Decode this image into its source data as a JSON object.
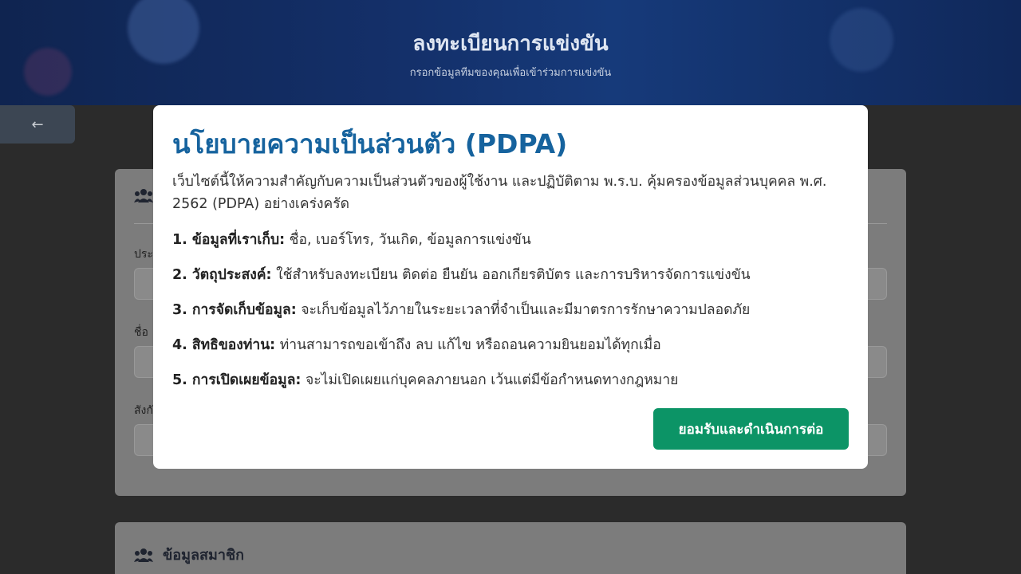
{
  "header": {
    "title": "ลงทะเบียนการแข่งขัน",
    "subtitle": "กรอกข้อมูลทีมของคุณเพื่อเข้าร่วมการแข่งขัน"
  },
  "back_button": {
    "icon": "arrow-left-icon",
    "glyph": "←"
  },
  "form": {
    "card1": {
      "fields": [
        {
          "label": "ประ"
        },
        {
          "label": "ชื่อ"
        },
        {
          "label": "สังกั"
        }
      ]
    },
    "card2": {
      "title": "ข้อมูลสมาชิก"
    }
  },
  "modal": {
    "title": "นโยบายความเป็นส่วนตัว (PDPA)",
    "intro": "เว็บไซต์นี้ให้ความสำคัญกับความเป็นส่วนตัวของผู้ใช้งาน และปฏิบัติตาม พ.ร.บ. คุ้มครองข้อมูลส่วนบุคคล พ.ศ. 2562 (PDPA) อย่างเคร่งครัด",
    "items": [
      {
        "heading": "1. ข้อมูลที่เราเก็บ:",
        "text": " ชื่อ, เบอร์โทร, วันเกิด, ข้อมูลการแข่งขัน"
      },
      {
        "heading": "2. วัตถุประสงค์:",
        "text": " ใช้สำหรับลงทะเบียน ติดต่อ ยืนยัน ออกเกียรติบัตร และการบริหารจัดการแข่งขัน"
      },
      {
        "heading": "3. การจัดเก็บข้อมูล:",
        "text": " จะเก็บข้อมูลไว้ภายในระยะเวลาที่จำเป็นและมีมาตรการรักษาความปลอดภัย"
      },
      {
        "heading": "4. สิทธิของท่าน:",
        "text": " ท่านสามารถขอเข้าถึง ลบ แก้ไข หรือถอนความยินยอมได้ทุกเมื่อ"
      },
      {
        "heading": "5. การเปิดเผยข้อมูล:",
        "text": " จะไม่เปิดเผยแก่บุคคลภายนอก เว้นแต่มีข้อกำหนดทางกฎหมาย"
      }
    ],
    "accept_label": "ยอมรับและดำเนินการต่อ"
  },
  "colors": {
    "accent": "#16639e",
    "button": "#0c9466"
  }
}
